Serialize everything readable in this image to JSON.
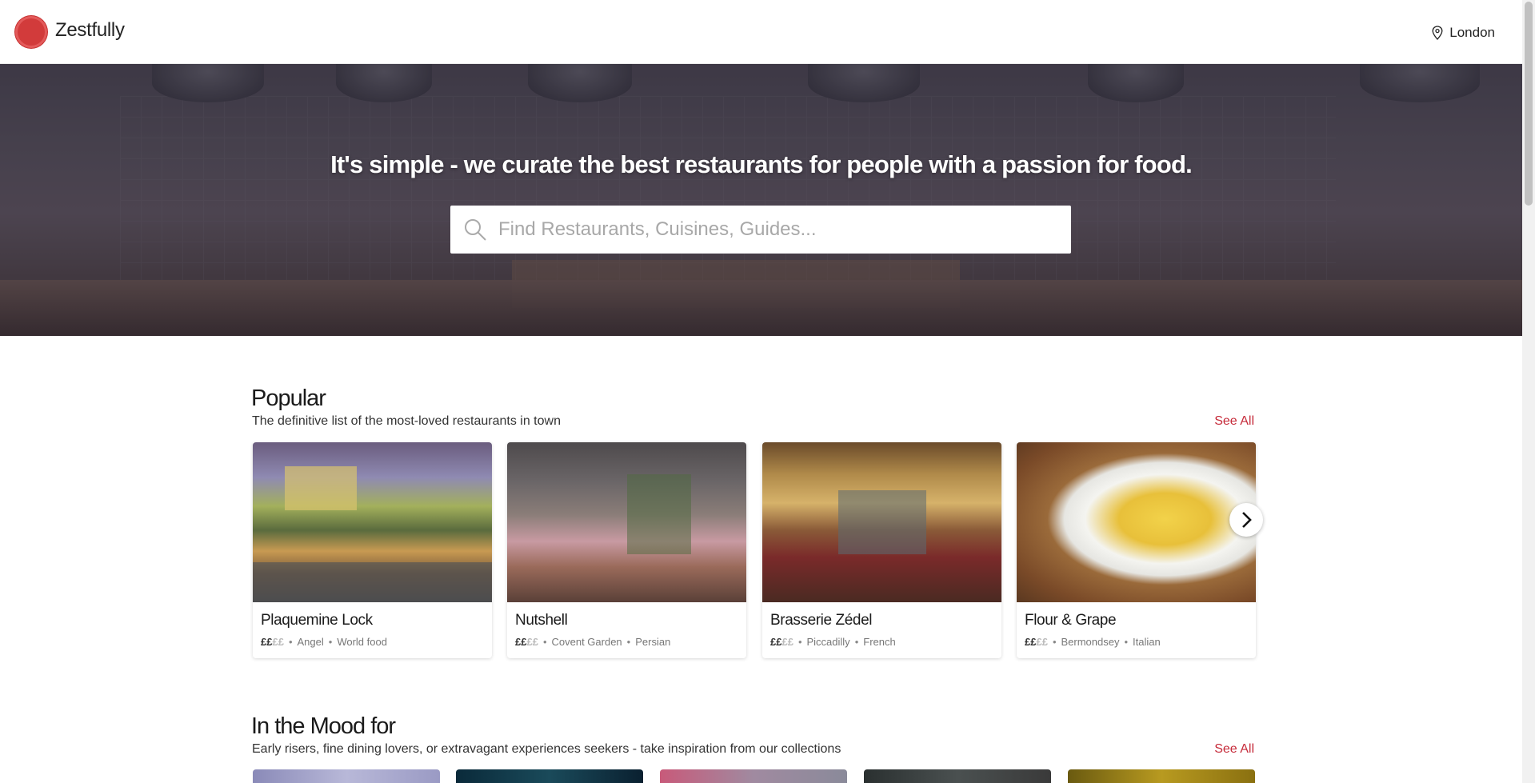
{
  "header": {
    "brand": "Zestfully",
    "location": "London",
    "colors": {
      "logo": "#d23b3b"
    }
  },
  "hero": {
    "headline": "It's simple - we curate the best restaurants for people with a passion for food.",
    "search_placeholder": "Find Restaurants, Cuisines, Guides..."
  },
  "popular": {
    "title": "Popular",
    "subtitle": "The definitive list of the most-loved restaurants in town",
    "see_all": "See All",
    "cards": [
      {
        "name": "Plaquemine Lock",
        "price_active": "££",
        "price_inactive": "££",
        "area": "Angel",
        "cuisine": "World food"
      },
      {
        "name": "Nutshell",
        "price_active": "££",
        "price_inactive": "££",
        "area": "Covent Garden",
        "cuisine": "Persian"
      },
      {
        "name": "Brasserie Zédel",
        "price_active": "££",
        "price_inactive": "££",
        "area": "Piccadilly",
        "cuisine": "French"
      },
      {
        "name": "Flour & Grape",
        "price_active": "££",
        "price_inactive": "££",
        "area": "Bermondsey",
        "cuisine": "Italian"
      }
    ]
  },
  "mood": {
    "title": "In the Mood for",
    "subtitle": "Early risers, fine dining lovers, or extravagant experiences seekers - take inspiration from our collections",
    "see_all": "See All"
  },
  "icons": {
    "location": "map-pin-icon",
    "search": "search-icon",
    "next": "chevron-right-icon"
  },
  "colors": {
    "accent": "#c62b3a"
  }
}
